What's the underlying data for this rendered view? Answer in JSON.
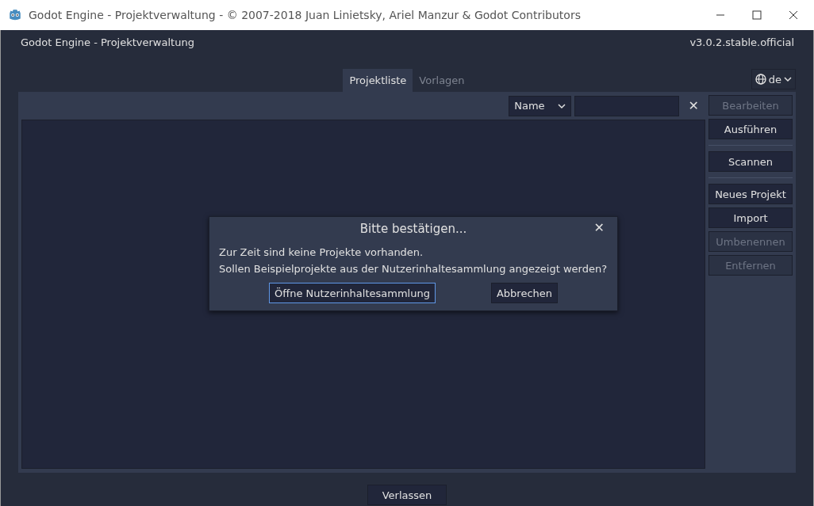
{
  "window": {
    "title": "Godot Engine - Projektverwaltung - © 2007-2018 Juan Linietsky, Ariel Manzur & Godot Contributors"
  },
  "header": {
    "title": "Godot Engine - Projektverwaltung",
    "version": "v3.0.2.stable.official"
  },
  "tabs": [
    {
      "label": "Projektliste",
      "selected": true
    },
    {
      "label": "Vorlagen",
      "selected": false
    }
  ],
  "language": "de",
  "toolbar": {
    "sort": "Name",
    "clear": "✕"
  },
  "button_groups": [
    [
      {
        "label": "Bearbeiten",
        "disabled": true
      },
      {
        "label": "Ausführen",
        "disabled": false
      }
    ],
    [
      {
        "label": "Scannen",
        "disabled": false
      }
    ],
    [
      {
        "label": "Neues Projekt",
        "disabled": false
      },
      {
        "label": "Import",
        "disabled": false
      },
      {
        "label": "Umbenennen",
        "disabled": true
      },
      {
        "label": "Entfernen",
        "disabled": true
      }
    ]
  ],
  "dialog": {
    "title": "Bitte bestätigen...",
    "close": "✕",
    "lines": [
      "Zur Zeit sind keine Projekte vorhanden.",
      "Sollen Beispielprojekte aus der Nutzerinhaltesammlung angezeigt werden?"
    ],
    "buttons": [
      {
        "label": "Öffne Nutzerinhaltesammlung",
        "focused": true
      },
      {
        "label": "Abbrechen",
        "focused": false
      }
    ]
  },
  "quit": "Verlassen"
}
